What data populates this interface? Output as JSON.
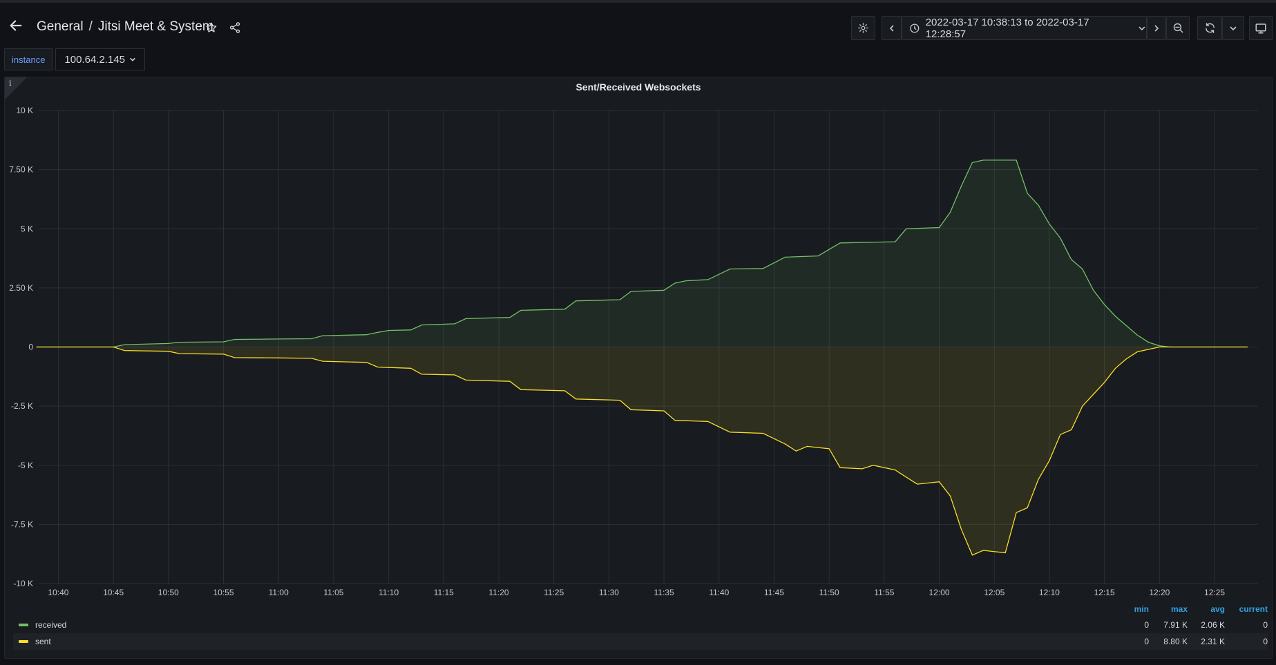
{
  "header": {
    "breadcrumb_folder": "General",
    "breadcrumb_sep": "/",
    "dashboard_title": "Jitsi Meet & System",
    "time_range": "2022-03-17 10:38:13 to 2022-03-17 12:28:57"
  },
  "variables": {
    "label": "instance",
    "value": "100.64.2.145"
  },
  "panel": {
    "title": "Sent/Received Websockets",
    "info": "i"
  },
  "legend": {
    "columns": [
      "min",
      "max",
      "avg",
      "current"
    ],
    "rows": [
      {
        "name": "received",
        "min": "0",
        "max": "7.91 K",
        "avg": "2.06 K",
        "current": "0"
      },
      {
        "name": "sent",
        "min": "0",
        "max": "8.80 K",
        "avg": "2.31 K",
        "current": "0"
      }
    ]
  },
  "colors": {
    "received": "#73bf69",
    "sent": "#fade2a",
    "accent": "#6e9fff",
    "legend_header": "#33a2e5"
  },
  "chart_data": {
    "type": "area",
    "title": "Sent/Received Websockets",
    "ylim": [
      -10000,
      10000
    ],
    "yticks": [
      10000,
      7500,
      5000,
      2500,
      0,
      -2500,
      -5000,
      -7500,
      -10000
    ],
    "ytick_labels": [
      "10 K",
      "7.50 K",
      "5 K",
      "2.50 K",
      "0",
      "-2.5 K",
      "-5 K",
      "-7.5 K",
      "-10 K"
    ],
    "xticks": [
      "10:40",
      "10:45",
      "10:50",
      "10:55",
      "11:00",
      "11:05",
      "11:10",
      "11:15",
      "11:20",
      "11:25",
      "11:30",
      "11:35",
      "11:40",
      "11:45",
      "11:50",
      "11:55",
      "12:00",
      "12:05",
      "12:10",
      "12:15",
      "12:20",
      "12:25"
    ],
    "xlim": [
      "10:38",
      "12:29"
    ],
    "grid": true,
    "legend": "bottom",
    "series": [
      {
        "name": "received",
        "points": [
          [
            "10:38",
            0
          ],
          [
            "10:45",
            0
          ],
          [
            "10:46",
            100
          ],
          [
            "10:50",
            150
          ],
          [
            "10:51",
            200
          ],
          [
            "10:55",
            220
          ],
          [
            "10:56",
            320
          ],
          [
            "11:00",
            340
          ],
          [
            "11:03",
            350
          ],
          [
            "11:04",
            480
          ],
          [
            "11:08",
            520
          ],
          [
            "11:09",
            620
          ],
          [
            "11:10",
            700
          ],
          [
            "11:12",
            720
          ],
          [
            "11:13",
            930
          ],
          [
            "11:16",
            980
          ],
          [
            "11:17",
            1200
          ],
          [
            "11:21",
            1250
          ],
          [
            "11:22",
            1550
          ],
          [
            "11:26",
            1600
          ],
          [
            "11:27",
            1950
          ],
          [
            "11:31",
            2000
          ],
          [
            "11:32",
            2350
          ],
          [
            "11:35",
            2400
          ],
          [
            "11:36",
            2700
          ],
          [
            "11:37",
            2800
          ],
          [
            "11:39",
            2850
          ],
          [
            "11:41",
            3300
          ],
          [
            "11:44",
            3320
          ],
          [
            "11:46",
            3800
          ],
          [
            "11:49",
            3850
          ],
          [
            "11:51",
            4400
          ],
          [
            "11:56",
            4450
          ],
          [
            "11:57",
            5000
          ],
          [
            "12:00",
            5050
          ],
          [
            "12:01",
            5700
          ],
          [
            "12:02",
            6800
          ],
          [
            "12:03",
            7800
          ],
          [
            "12:04",
            7900
          ],
          [
            "12:07",
            7900
          ],
          [
            "12:08",
            6500
          ],
          [
            "12:09",
            6000
          ],
          [
            "12:10",
            5200
          ],
          [
            "12:11",
            4600
          ],
          [
            "12:12",
            3700
          ],
          [
            "12:13",
            3300
          ],
          [
            "12:14",
            2400
          ],
          [
            "12:15",
            1800
          ],
          [
            "12:16",
            1300
          ],
          [
            "12:17",
            900
          ],
          [
            "12:18",
            500
          ],
          [
            "12:19",
            200
          ],
          [
            "12:20",
            50
          ],
          [
            "12:21",
            0
          ],
          [
            "12:28",
            0
          ]
        ]
      },
      {
        "name": "sent",
        "points": [
          [
            "10:38",
            0
          ],
          [
            "10:45",
            0
          ],
          [
            "10:46",
            -150
          ],
          [
            "10:50",
            -180
          ],
          [
            "10:51",
            -280
          ],
          [
            "10:55",
            -300
          ],
          [
            "10:56",
            -450
          ],
          [
            "11:00",
            -460
          ],
          [
            "11:03",
            -480
          ],
          [
            "11:04",
            -600
          ],
          [
            "11:08",
            -650
          ],
          [
            "11:09",
            -850
          ],
          [
            "11:12",
            -900
          ],
          [
            "11:13",
            -1150
          ],
          [
            "11:16",
            -1180
          ],
          [
            "11:17",
            -1400
          ],
          [
            "11:21",
            -1450
          ],
          [
            "11:22",
            -1800
          ],
          [
            "11:26",
            -1850
          ],
          [
            "11:27",
            -2200
          ],
          [
            "11:31",
            -2250
          ],
          [
            "11:32",
            -2650
          ],
          [
            "11:35",
            -2700
          ],
          [
            "11:36",
            -3100
          ],
          [
            "11:39",
            -3150
          ],
          [
            "11:41",
            -3600
          ],
          [
            "11:44",
            -3650
          ],
          [
            "11:46",
            -4100
          ],
          [
            "11:47",
            -4400
          ],
          [
            "11:48",
            -4200
          ],
          [
            "11:50",
            -4300
          ],
          [
            "11:51",
            -5100
          ],
          [
            "11:53",
            -5150
          ],
          [
            "11:54",
            -5000
          ],
          [
            "11:56",
            -5200
          ],
          [
            "11:57",
            -5500
          ],
          [
            "11:58",
            -5800
          ],
          [
            "12:00",
            -5700
          ],
          [
            "12:01",
            -6300
          ],
          [
            "12:02",
            -7700
          ],
          [
            "12:03",
            -8800
          ],
          [
            "12:04",
            -8600
          ],
          [
            "12:06",
            -8700
          ],
          [
            "12:07",
            -7000
          ],
          [
            "12:08",
            -6800
          ],
          [
            "12:09",
            -5600
          ],
          [
            "12:10",
            -4800
          ],
          [
            "12:11",
            -3700
          ],
          [
            "12:12",
            -3500
          ],
          [
            "12:13",
            -2500
          ],
          [
            "12:14",
            -2000
          ],
          [
            "12:15",
            -1500
          ],
          [
            "12:16",
            -900
          ],
          [
            "12:17",
            -500
          ],
          [
            "12:18",
            -200
          ],
          [
            "12:20",
            0
          ],
          [
            "12:28",
            0
          ]
        ]
      }
    ]
  }
}
